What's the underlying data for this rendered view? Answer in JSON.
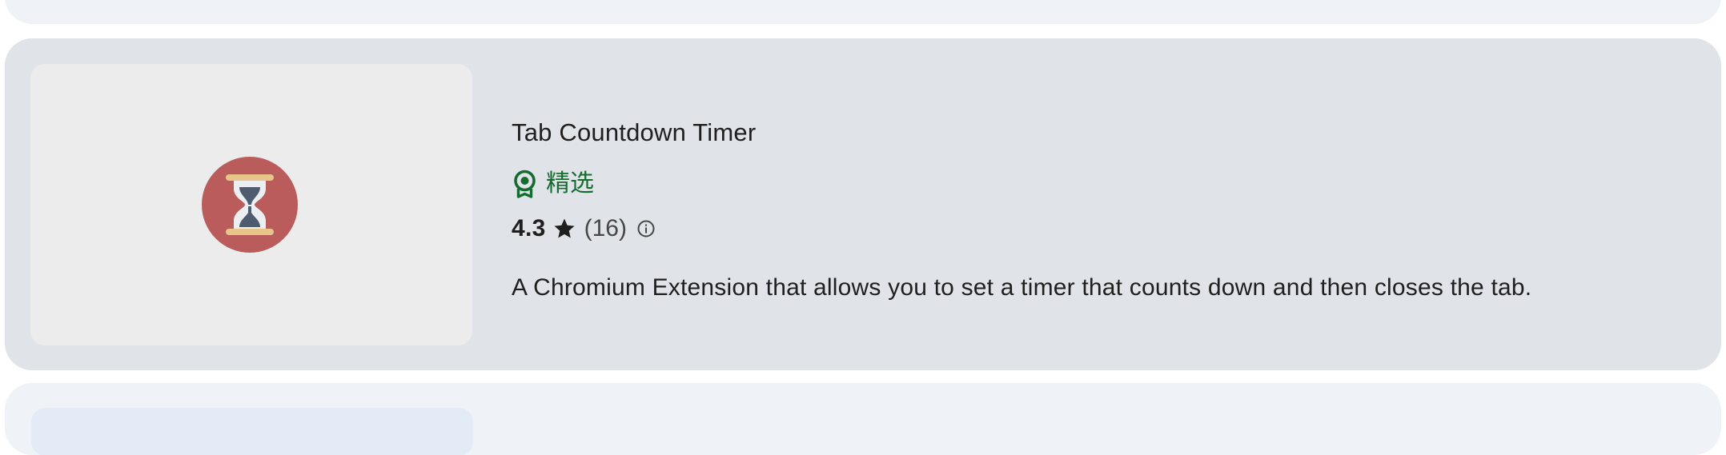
{
  "extension": {
    "title": "Tab Countdown Timer",
    "featured_label": "精选",
    "rating": "4.3",
    "review_count": "(16)",
    "description": "A Chromium Extension that allows you to set a timer that counts down and then closes the tab."
  },
  "icons": {
    "logo": "hourglass-icon",
    "badge": "featured-badge-icon",
    "star": "star-icon",
    "info": "info-icon"
  },
  "colors": {
    "card_background": "#e0e3e8",
    "adjacent_card_background": "#eff2f7",
    "thumbnail_background": "#ebeceb",
    "featured_green": "#146c2e",
    "logo_red": "#b95c5b"
  }
}
